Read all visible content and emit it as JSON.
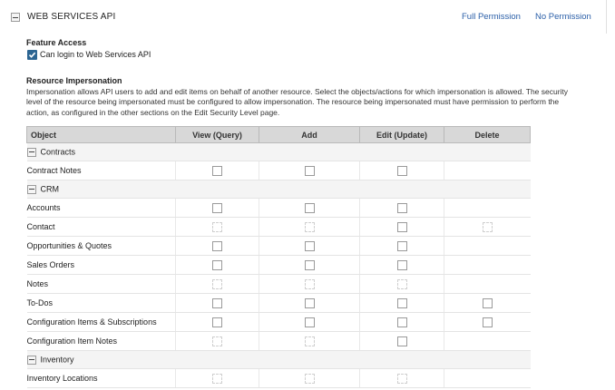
{
  "header": {
    "title": "WEB SERVICES API",
    "full_permission": "Full Permission",
    "no_permission": "No Permission"
  },
  "feature_access": {
    "title": "Feature Access",
    "checkbox_label": "Can login to Web Services API",
    "checked": true
  },
  "resource_impersonation": {
    "title": "Resource Impersonation",
    "description": "Impersonation allows API users to add and edit items on behalf of another resource. Select the objects/actions for which impersonation is allowed. The security level of the resource being impersonated must be configured to allow impersonation. The resource being impersonated must have permission to perform the action, as configured in the other sections on the Edit Security Level page."
  },
  "table": {
    "columns": [
      "Object",
      "View (Query)",
      "Add",
      "Edit (Update)",
      "Delete"
    ]
  },
  "groups": [
    {
      "name": "Contracts",
      "rows": [
        {
          "name": "Contract Notes",
          "checks": [
            1,
            1,
            1,
            0
          ]
        }
      ]
    },
    {
      "name": "CRM",
      "rows": [
        {
          "name": "Accounts",
          "checks": [
            1,
            1,
            1,
            0
          ]
        },
        {
          "name": "Contact",
          "checks": [
            2,
            2,
            1,
            2
          ]
        },
        {
          "name": "Opportunities & Quotes",
          "checks": [
            1,
            1,
            1,
            0
          ]
        },
        {
          "name": "Sales Orders",
          "checks": [
            1,
            1,
            1,
            0
          ]
        },
        {
          "name": "Notes",
          "checks": [
            2,
            2,
            2,
            0
          ]
        },
        {
          "name": "To-Dos",
          "checks": [
            1,
            1,
            1,
            1
          ]
        },
        {
          "name": "Configuration Items & Subscriptions",
          "checks": [
            1,
            1,
            1,
            1
          ]
        },
        {
          "name": "Configuration Item Notes",
          "checks": [
            2,
            2,
            1,
            0
          ]
        }
      ]
    },
    {
      "name": "Inventory",
      "rows": [
        {
          "name": "Inventory Locations",
          "checks": [
            2,
            2,
            2,
            0
          ]
        }
      ]
    }
  ]
}
